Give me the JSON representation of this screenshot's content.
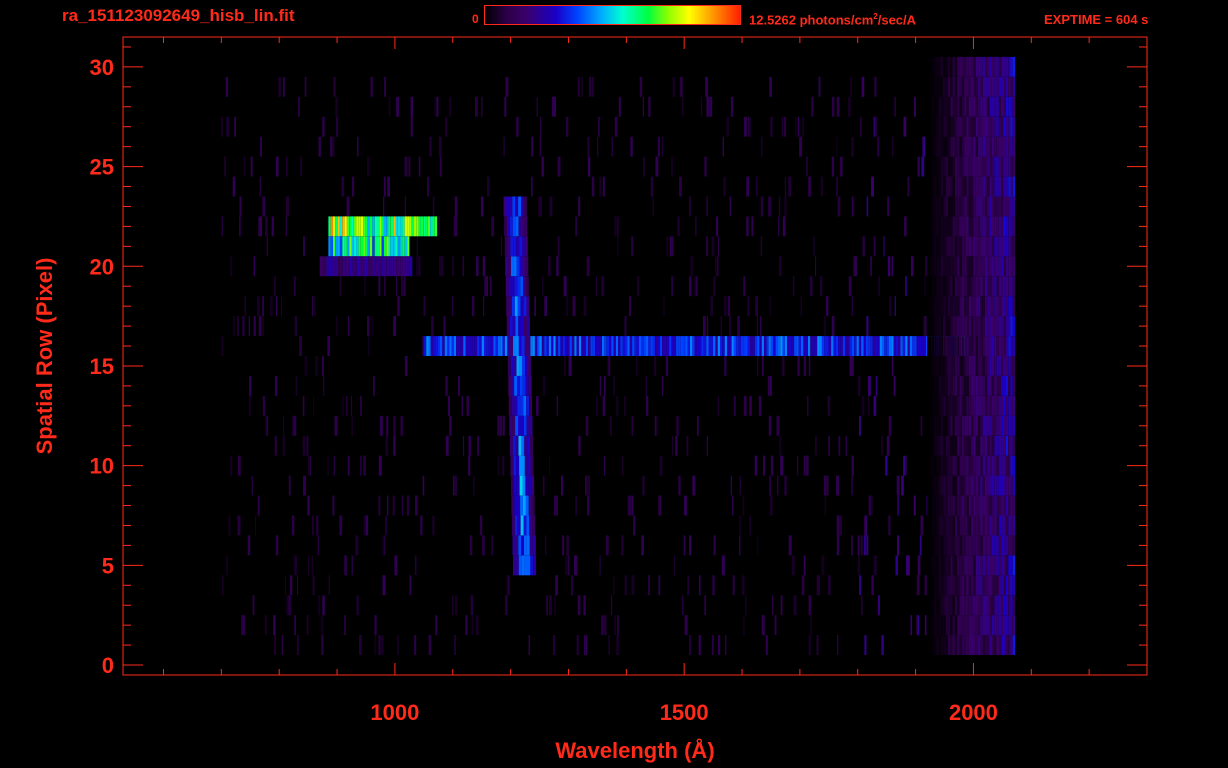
{
  "header": {
    "file_title": "ra_151123092649_hisb_lin.fit",
    "colorbar_min": "0",
    "colorbar_max_value": "12.5262",
    "colorbar_unit_prefix": " photons/cm",
    "colorbar_unit_exp": "2",
    "colorbar_unit_suffix": "/sec/A",
    "exptime": "EXPTIME = 604 s"
  },
  "colors": {
    "axis": "#ff2a1a",
    "background": "#000000"
  },
  "chart_data": {
    "type": "heatmap",
    "title": "ra_151123092649_hisb_lin.fit",
    "xlabel": "Wavelength (Å)",
    "ylabel": "Spatial Row (Pixel)",
    "xlim": [
      530,
      2300
    ],
    "ylim": [
      -0.5,
      31.5
    ],
    "x_ticks": [
      1000,
      1500,
      2000
    ],
    "y_ticks": [
      0,
      5,
      10,
      15,
      20,
      25,
      30
    ],
    "value_range": [
      0,
      12.5262
    ],
    "value_unit": "photons/cm²/sec/A",
    "grid": false,
    "features": [
      {
        "name": "continuum band",
        "row": 16,
        "x_range": [
          1050,
          1985
        ],
        "level": 4.5
      },
      {
        "name": "bright band upper",
        "row": 22,
        "x_range": [
          885,
          1070
        ],
        "level": 9.5
      },
      {
        "name": "bright band lower",
        "row": 21,
        "x_range": [
          885,
          1025
        ],
        "level": 7.5
      },
      {
        "name": "faint band",
        "row": 20,
        "x_range": [
          870,
          1030
        ],
        "level": 2.5
      },
      {
        "name": "emission line",
        "x_center": 1216,
        "row_range": [
          5,
          23
        ],
        "level": 6.0
      },
      {
        "name": "detector edge",
        "x_range": [
          1920,
          2070
        ],
        "row_range": [
          1,
          30
        ],
        "level": 3.5
      }
    ]
  }
}
